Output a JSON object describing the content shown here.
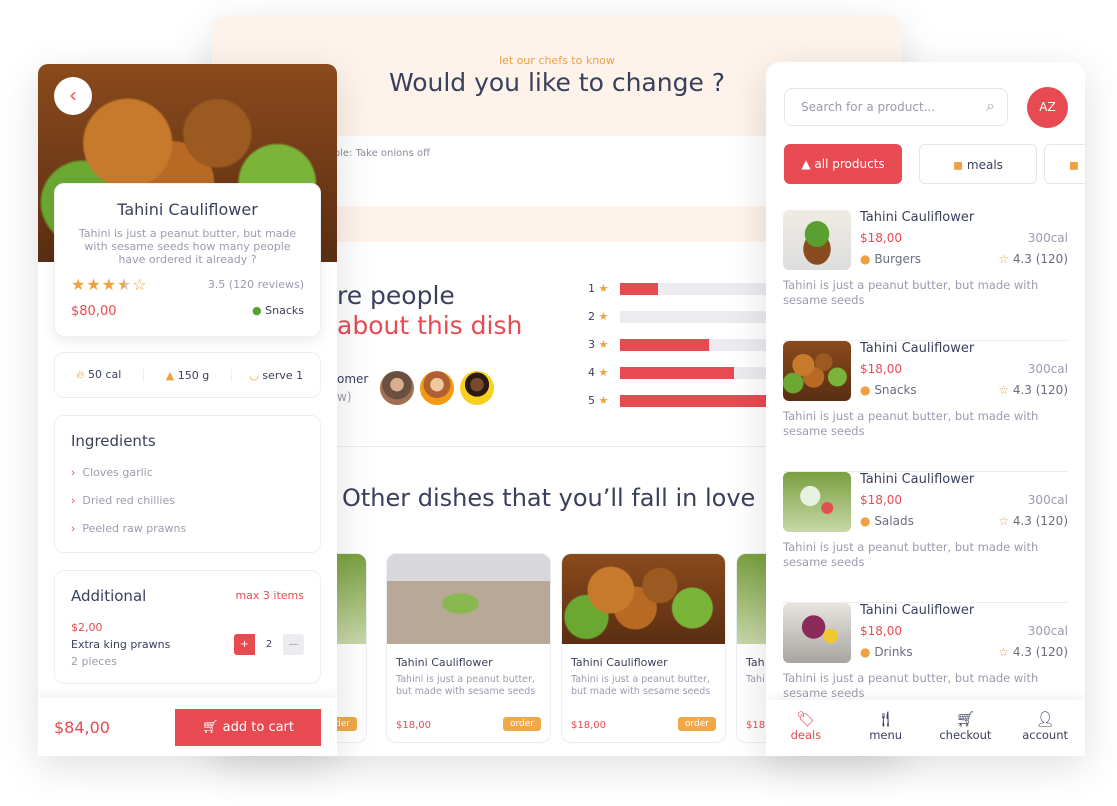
{
  "middle": {
    "eyebrow": "let our chefs to know",
    "title": "Would you like to change ?",
    "note_placeholder": "mple: Take onions off",
    "reviews_title_1": "re people",
    "reviews_title_2": "about this dish",
    "customer_label": "omer",
    "customer_sub": "w)",
    "rating_bars": [
      {
        "star": "1",
        "fraction": 0.25
      },
      {
        "star": "2",
        "fraction": 0
      },
      {
        "star": "3",
        "fraction": 0.59
      },
      {
        "star": "4",
        "fraction": 0.76
      },
      {
        "star": "5",
        "fraction": 1.0
      }
    ],
    "other_title": "Other dishes that you’ll fall in love",
    "dishes": [
      {
        "name": "",
        "desc": "",
        "price": "",
        "order": "order"
      },
      {
        "name": "Tahini Cauliflower",
        "desc": "Tahini is just a peanut butter, but made with sesame seeds",
        "price": "$18,00",
        "order": "order"
      },
      {
        "name": "Tahini Cauliflower",
        "desc": "Tahini is just a peanut butter, but made with sesame seeds",
        "price": "$18,00",
        "order": "order"
      },
      {
        "name": "Tah",
        "desc": "Tahi butt sesa",
        "price": "$18,",
        "order": ""
      }
    ]
  },
  "left": {
    "name": "Tahini Cauliflower",
    "desc": "Tahini is just a peanut butter, but made with sesame seeds how many people have ordered it already ?",
    "rating": 3.5,
    "rating_text": "3.5 (120 reviews)",
    "price": "$80,00",
    "category": "Snacks",
    "stats": [
      "50 cal",
      "150 g",
      "serve 1"
    ],
    "ingredients_title": "Ingredients",
    "ingredients": [
      "Cloves garlic",
      "Dried red chillies",
      "Peeled raw prawns"
    ],
    "additional_title": "Additional",
    "additional_max": "max 3 items",
    "extra_price": "$2,00",
    "extra_name": "Extra king prawns",
    "extra_sub": "2 pieces",
    "qty": "2",
    "total": "$84,00",
    "add_to_cart": "add to cart"
  },
  "right": {
    "search_placeholder": "Search for a product...",
    "sort_label": "AZ",
    "chips": [
      {
        "label": "all products",
        "active": true
      },
      {
        "label": "meals",
        "active": false
      },
      {
        "label": "",
        "active": false
      }
    ],
    "products": [
      {
        "name": "Tahini Cauliflower",
        "price": "$18,00",
        "cal": "300cal",
        "category": "Burgers",
        "rating": "4.3 (120)",
        "desc": "Tahini is just a peanut butter, but made with sesame seeds",
        "img": "burger"
      },
      {
        "name": "Tahini Cauliflower",
        "price": "$18,00",
        "cal": "300cal",
        "category": "Snacks",
        "rating": "4.3 (120)",
        "desc": "Tahini is just a peanut butter, but made with sesame seeds",
        "img": "food"
      },
      {
        "name": "Tahini Cauliflower",
        "price": "$18,00",
        "cal": "300cal",
        "category": "Salads",
        "rating": "4.3 (120)",
        "desc": "Tahini is just a peanut butter, but made with sesame seeds",
        "img": "salad"
      },
      {
        "name": "Tahini Cauliflower",
        "price": "$18,00",
        "cal": "300cal",
        "category": "Drinks",
        "rating": "4.3 (120)",
        "desc": "Tahini is just a peanut butter, but made with sesame seeds",
        "img": "berry"
      }
    ],
    "nav": [
      {
        "label": "deals",
        "icon": "tag-icon",
        "active": true
      },
      {
        "label": "menu",
        "icon": "utensils-icon",
        "active": false
      },
      {
        "label": "checkout",
        "icon": "cart-icon",
        "active": false
      },
      {
        "label": "account",
        "icon": "user-icon",
        "active": false
      }
    ]
  },
  "colors": {
    "accent": "#e84a52",
    "orange": "#f0a040",
    "cream": "#fdf3ea",
    "text": "#3a3f5c"
  }
}
